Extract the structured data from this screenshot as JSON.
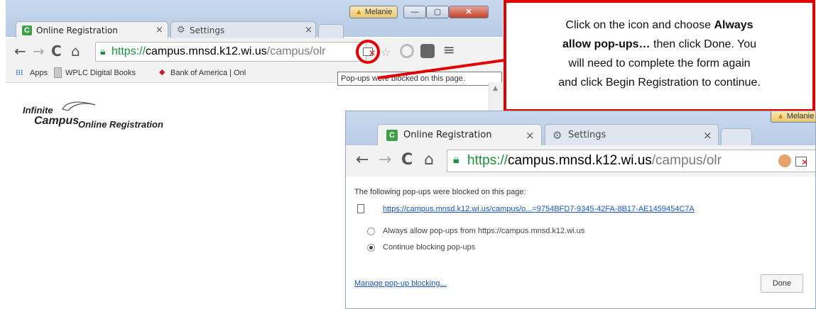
{
  "bg_browser": {
    "tabs": [
      {
        "label": "Online Registration",
        "favicon": "C"
      },
      {
        "label": "Settings",
        "favicon": "gear-icon"
      }
    ],
    "window_user": "Melanie",
    "url_scheme": "https://",
    "url_host": "campus.mnsd.k12.wi.us",
    "url_path": "/campus/olr",
    "bookmarks": [
      {
        "label": "Apps"
      },
      {
        "label": "WPLC Digital Books"
      },
      {
        "label": "Bank of America | Onl"
      }
    ],
    "tooltip": "Pop-ups were blocked on this page.",
    "logo_line1": "Infinite",
    "logo_line2": "Campus",
    "logo_product": "Online Registration"
  },
  "callout": {
    "text_1": "Click on the icon and choose ",
    "bold_1": "Always",
    "bold_2": "allow pop-ups…",
    "text_2": " then click Done.  You",
    "text_3": "will need to complete the form again",
    "text_4": "and click Begin Registration to continue."
  },
  "fg_browser": {
    "tabs": [
      {
        "label": "Online Registration",
        "favicon": "C"
      },
      {
        "label": "Settings",
        "favicon": "gear-icon"
      }
    ],
    "window_user": "Melanie",
    "url_scheme": "https://",
    "url_host": "campus.mnsd.k12.wi.us",
    "url_path": "/campus/olr",
    "popup": {
      "heading": "The following pop-ups were blocked on this page:",
      "link": "https://campus.mnsd.k12.wi.us/campus/o...=9754BFD7-9345-42FA-8B17-AE1459454C7A",
      "option_allow": "Always allow pop-ups from https://campus.mnsd.k12.wi.us",
      "option_block": "Continue blocking pop-ups",
      "selected": "option_block",
      "manage_link": "Manage pop-up blocking...",
      "done_label": "Done"
    }
  },
  "colors": {
    "accent_red": "#e10000",
    "link_blue": "#1a55b8",
    "https_green": "#1a8f3a"
  }
}
